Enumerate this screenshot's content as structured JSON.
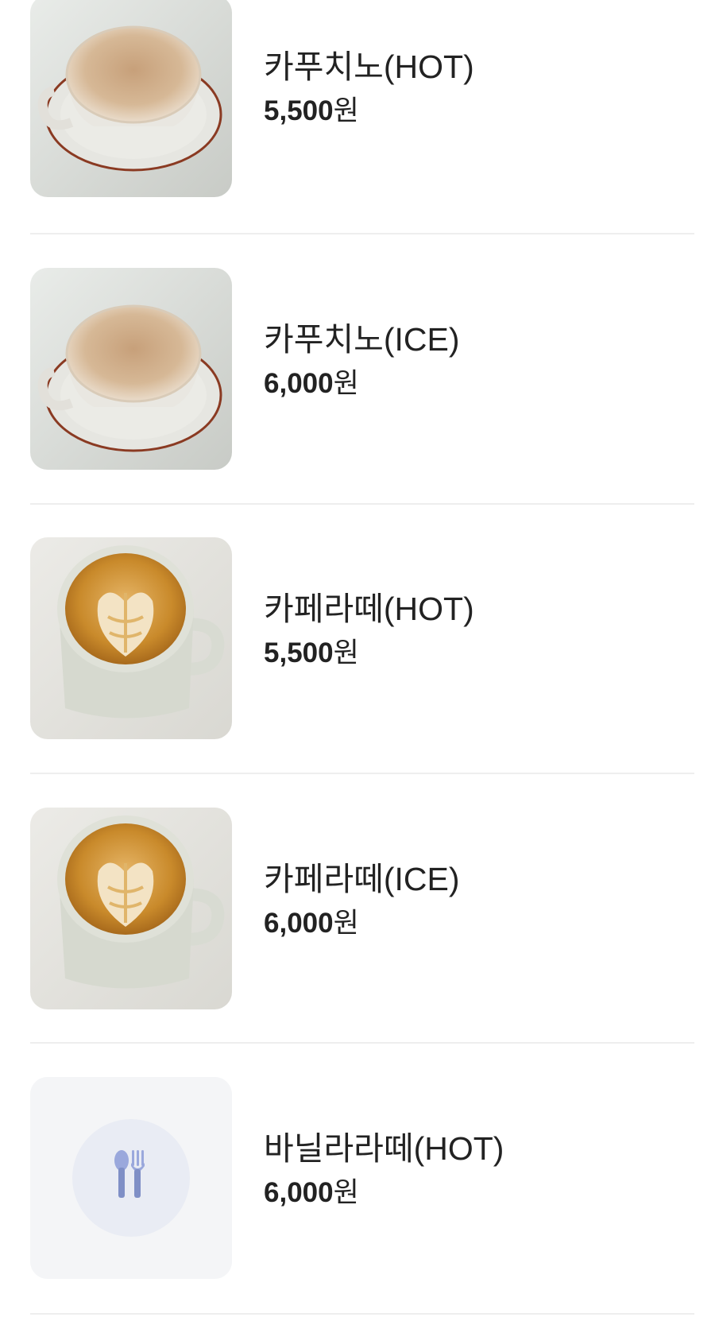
{
  "menu": {
    "items": [
      {
        "name": "카푸치노(HOT)",
        "price": "5,500",
        "unit": "원",
        "image": "cappuccino-photo"
      },
      {
        "name": "카푸치노(ICE)",
        "price": "6,000",
        "unit": "원",
        "image": "cappuccino-photo"
      },
      {
        "name": "카페라떼(HOT)",
        "price": "5,500",
        "unit": "원",
        "image": "latte-photo"
      },
      {
        "name": "카페라떼(ICE)",
        "price": "6,000",
        "unit": "원",
        "image": "latte-photo"
      },
      {
        "name": "바닐라라떼(HOT)",
        "price": "6,000",
        "unit": "원",
        "image": "utensils-icon"
      }
    ]
  },
  "colors": {
    "text": "#222222",
    "divider": "#eeeeee",
    "placeholder_bg": "#f4f5f7",
    "placeholder_icon": "#7f8fc6"
  }
}
